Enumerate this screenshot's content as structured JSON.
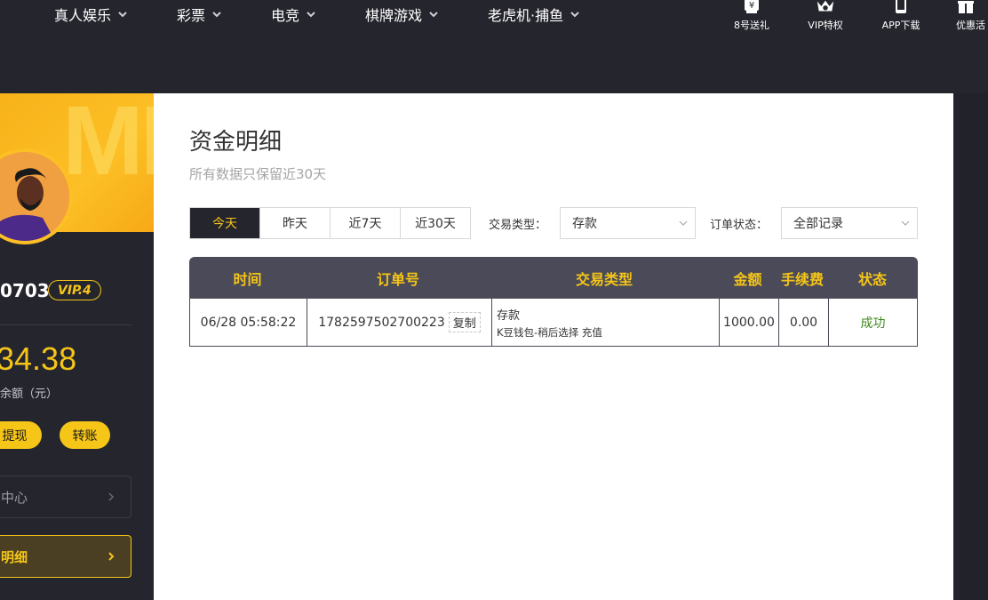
{
  "nav": {
    "items": [
      {
        "label": "真人娱乐"
      },
      {
        "label": "彩票"
      },
      {
        "label": "电竞"
      },
      {
        "label": "棋牌游戏"
      },
      {
        "label": "老虎机·捕鱼"
      }
    ],
    "right": [
      {
        "label": "8号送礼",
        "icon": "yen-gift-icon"
      },
      {
        "label": "VIP特权",
        "icon": "crown-icon"
      },
      {
        "label": "APP下载",
        "icon": "phone-icon"
      },
      {
        "label": "优惠活",
        "icon": "gift-icon"
      }
    ]
  },
  "sidebar": {
    "username": "0703",
    "vip": "VIP.4",
    "balance": "34.38",
    "balance_label": "余额（元）",
    "withdraw": "提现",
    "transfer": "转账",
    "menu": [
      {
        "label": "中心"
      },
      {
        "label": "明细"
      }
    ]
  },
  "main": {
    "title": "资金明细",
    "subtitle": "所有数据只保留近30天",
    "ranges": [
      "今天",
      "昨天",
      "近7天",
      "近30天"
    ],
    "type_label": "交易类型：",
    "type_value": "存款",
    "status_label": "订单状态：",
    "status_value": "全部记录",
    "table": {
      "headers": [
        "时间",
        "订单号",
        "交易类型",
        "金额",
        "手续费",
        "状态"
      ],
      "rows": [
        {
          "time": "06/28 05:58:22",
          "order": "1782597502700223",
          "copy": "复制",
          "type": "存款",
          "type_detail": "K豆钱包-稍后选择 充值",
          "amount": "1000.00",
          "fee": "0.00",
          "status": "成功"
        }
      ]
    }
  },
  "colors": {
    "accent": "#f5c518",
    "nav_bg": "#25252e",
    "header_bg": "#4a4a58",
    "success": "#3d8a1e"
  }
}
